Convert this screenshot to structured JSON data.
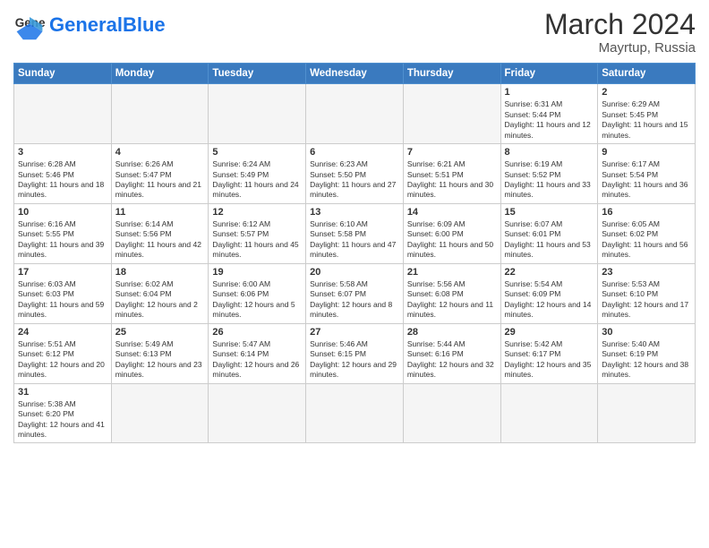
{
  "header": {
    "logo_general": "General",
    "logo_blue": "Blue",
    "month_title": "March 2024",
    "location": "Mayrtup, Russia"
  },
  "days_of_week": [
    "Sunday",
    "Monday",
    "Tuesday",
    "Wednesday",
    "Thursday",
    "Friday",
    "Saturday"
  ],
  "weeks": [
    [
      {
        "day": "",
        "info": "",
        "empty": true
      },
      {
        "day": "",
        "info": "",
        "empty": true
      },
      {
        "day": "",
        "info": "",
        "empty": true
      },
      {
        "day": "",
        "info": "",
        "empty": true
      },
      {
        "day": "",
        "info": "",
        "empty": true
      },
      {
        "day": "1",
        "info": "Sunrise: 6:31 AM\nSunset: 5:44 PM\nDaylight: 11 hours and 12 minutes."
      },
      {
        "day": "2",
        "info": "Sunrise: 6:29 AM\nSunset: 5:45 PM\nDaylight: 11 hours and 15 minutes."
      }
    ],
    [
      {
        "day": "3",
        "info": "Sunrise: 6:28 AM\nSunset: 5:46 PM\nDaylight: 11 hours and 18 minutes."
      },
      {
        "day": "4",
        "info": "Sunrise: 6:26 AM\nSunset: 5:47 PM\nDaylight: 11 hours and 21 minutes."
      },
      {
        "day": "5",
        "info": "Sunrise: 6:24 AM\nSunset: 5:49 PM\nDaylight: 11 hours and 24 minutes."
      },
      {
        "day": "6",
        "info": "Sunrise: 6:23 AM\nSunset: 5:50 PM\nDaylight: 11 hours and 27 minutes."
      },
      {
        "day": "7",
        "info": "Sunrise: 6:21 AM\nSunset: 5:51 PM\nDaylight: 11 hours and 30 minutes."
      },
      {
        "day": "8",
        "info": "Sunrise: 6:19 AM\nSunset: 5:52 PM\nDaylight: 11 hours and 33 minutes."
      },
      {
        "day": "9",
        "info": "Sunrise: 6:17 AM\nSunset: 5:54 PM\nDaylight: 11 hours and 36 minutes."
      }
    ],
    [
      {
        "day": "10",
        "info": "Sunrise: 6:16 AM\nSunset: 5:55 PM\nDaylight: 11 hours and 39 minutes."
      },
      {
        "day": "11",
        "info": "Sunrise: 6:14 AM\nSunset: 5:56 PM\nDaylight: 11 hours and 42 minutes."
      },
      {
        "day": "12",
        "info": "Sunrise: 6:12 AM\nSunset: 5:57 PM\nDaylight: 11 hours and 45 minutes."
      },
      {
        "day": "13",
        "info": "Sunrise: 6:10 AM\nSunset: 5:58 PM\nDaylight: 11 hours and 47 minutes."
      },
      {
        "day": "14",
        "info": "Sunrise: 6:09 AM\nSunset: 6:00 PM\nDaylight: 11 hours and 50 minutes."
      },
      {
        "day": "15",
        "info": "Sunrise: 6:07 AM\nSunset: 6:01 PM\nDaylight: 11 hours and 53 minutes."
      },
      {
        "day": "16",
        "info": "Sunrise: 6:05 AM\nSunset: 6:02 PM\nDaylight: 11 hours and 56 minutes."
      }
    ],
    [
      {
        "day": "17",
        "info": "Sunrise: 6:03 AM\nSunset: 6:03 PM\nDaylight: 11 hours and 59 minutes."
      },
      {
        "day": "18",
        "info": "Sunrise: 6:02 AM\nSunset: 6:04 PM\nDaylight: 12 hours and 2 minutes."
      },
      {
        "day": "19",
        "info": "Sunrise: 6:00 AM\nSunset: 6:06 PM\nDaylight: 12 hours and 5 minutes."
      },
      {
        "day": "20",
        "info": "Sunrise: 5:58 AM\nSunset: 6:07 PM\nDaylight: 12 hours and 8 minutes."
      },
      {
        "day": "21",
        "info": "Sunrise: 5:56 AM\nSunset: 6:08 PM\nDaylight: 12 hours and 11 minutes."
      },
      {
        "day": "22",
        "info": "Sunrise: 5:54 AM\nSunset: 6:09 PM\nDaylight: 12 hours and 14 minutes."
      },
      {
        "day": "23",
        "info": "Sunrise: 5:53 AM\nSunset: 6:10 PM\nDaylight: 12 hours and 17 minutes."
      }
    ],
    [
      {
        "day": "24",
        "info": "Sunrise: 5:51 AM\nSunset: 6:12 PM\nDaylight: 12 hours and 20 minutes."
      },
      {
        "day": "25",
        "info": "Sunrise: 5:49 AM\nSunset: 6:13 PM\nDaylight: 12 hours and 23 minutes."
      },
      {
        "day": "26",
        "info": "Sunrise: 5:47 AM\nSunset: 6:14 PM\nDaylight: 12 hours and 26 minutes."
      },
      {
        "day": "27",
        "info": "Sunrise: 5:46 AM\nSunset: 6:15 PM\nDaylight: 12 hours and 29 minutes."
      },
      {
        "day": "28",
        "info": "Sunrise: 5:44 AM\nSunset: 6:16 PM\nDaylight: 12 hours and 32 minutes."
      },
      {
        "day": "29",
        "info": "Sunrise: 5:42 AM\nSunset: 6:17 PM\nDaylight: 12 hours and 35 minutes."
      },
      {
        "day": "30",
        "info": "Sunrise: 5:40 AM\nSunset: 6:19 PM\nDaylight: 12 hours and 38 minutes."
      }
    ],
    [
      {
        "day": "31",
        "info": "Sunrise: 5:38 AM\nSunset: 6:20 PM\nDaylight: 12 hours and 41 minutes."
      },
      {
        "day": "",
        "info": "",
        "empty": true
      },
      {
        "day": "",
        "info": "",
        "empty": true
      },
      {
        "day": "",
        "info": "",
        "empty": true
      },
      {
        "day": "",
        "info": "",
        "empty": true
      },
      {
        "day": "",
        "info": "",
        "empty": true
      },
      {
        "day": "",
        "info": "",
        "empty": true
      }
    ]
  ]
}
